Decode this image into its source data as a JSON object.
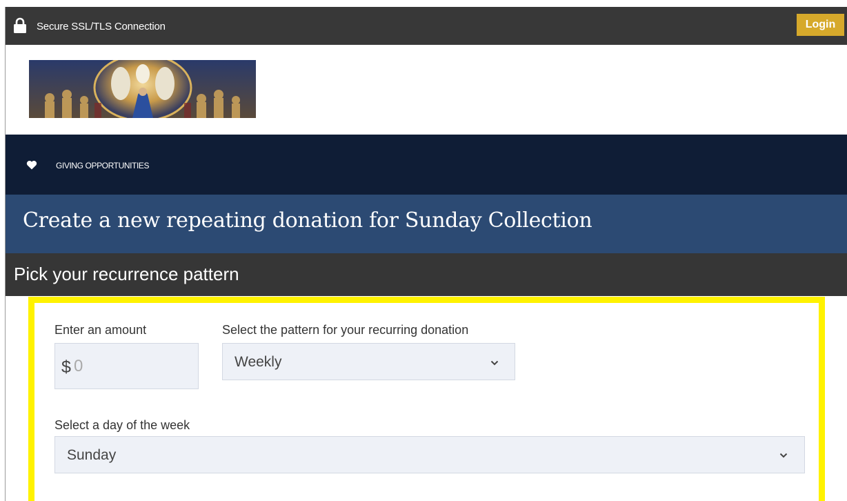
{
  "topbar": {
    "ssl_text": "Secure SSL/TLS Connection",
    "login_label": "Login",
    "lock_icon": "lock-icon",
    "bg_color": "#383838",
    "login_color": "#d6a92b"
  },
  "banner": {
    "icon": "church-mural-banner"
  },
  "nav": {
    "label": "GIVING OPPORTUNITIES",
    "icon": "heart-icon",
    "bg_color": "#0f1d36"
  },
  "page": {
    "title": "Create a new repeating donation for Sunday Collection",
    "section_heading": "Pick your recurrence pattern",
    "title_bg": "#2c4a73"
  },
  "form": {
    "amount_label": "Enter an amount",
    "currency_symbol": "$",
    "amount_placeholder": "0",
    "amount_value": "",
    "pattern_label": "Select the pattern for your recurring donation",
    "pattern_value": "Weekly",
    "day_label": "Select a day of the week",
    "day_value": "Sunday",
    "highlight_color": "#fff200"
  }
}
